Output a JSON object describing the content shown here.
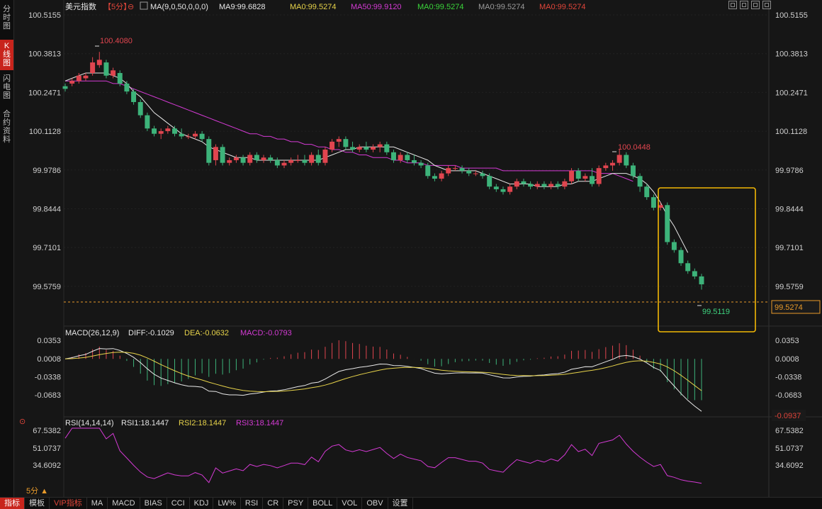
{
  "sidebar": {
    "tabs": [
      {
        "label": "分\n时\n图",
        "active": false
      },
      {
        "label": "K\n线\n图",
        "active": true
      },
      {
        "label": "闪\n电\n图",
        "active": false
      },
      {
        "label": "合\n约\n资\n料",
        "active": false
      }
    ]
  },
  "header": {
    "symbol": "美元指数",
    "period": "【5分】",
    "ma_config": "MA(9,0,50,0,0,0)",
    "items": [
      {
        "text": "MA9:99.6828",
        "color": "#e8e8e8"
      },
      {
        "text": "MA0:99.5274",
        "color": "#e7d34a"
      },
      {
        "text": "MA50:99.9120",
        "color": "#d43ad4"
      },
      {
        "text": "MA0:99.5274",
        "color": "#3ad43a"
      },
      {
        "text": "MA0:99.5274",
        "color": "#9a9a9a"
      },
      {
        "text": "MA0:99.5274",
        "color": "#e0453a"
      }
    ]
  },
  "price_axis": {
    "ticks": [
      "100.5155",
      "100.3813",
      "100.2471",
      "100.1128",
      "99.9786",
      "99.8444",
      "99.7101",
      "99.5759"
    ],
    "current_price": "99.5274"
  },
  "annotations": {
    "high1": "100.4080",
    "high2": "100.0448",
    "low": "99.5119"
  },
  "macd": {
    "title": "MACD(26,12,9)",
    "diff": "DIFF:-0.1029",
    "dea": "DEA:-0.0632",
    "macd": "MACD:-0.0793",
    "ticks": [
      "0.0353",
      "0.0008",
      "-0.0338",
      "-0.0683"
    ],
    "current": "-0.0937"
  },
  "rsi": {
    "title": "RSI(14,14,14)",
    "rsi1": "RSI1:18.1447",
    "rsi2": "RSI2:18.1447",
    "rsi3": "RSI3:18.1447",
    "ticks": [
      "67.5382",
      "51.0737",
      "34.6092"
    ]
  },
  "period_selector": "5分 ▲",
  "bottom_tabs": [
    "指标",
    "模板",
    "VIP指标",
    "MA",
    "MACD",
    "BIAS",
    "CCI",
    "KDJ",
    "LW%",
    "RSI",
    "CR",
    "PSY",
    "BOLL",
    "VOL",
    "OBV",
    "设置"
  ],
  "colors": {
    "up": "#e0454f",
    "down": "#3db37a",
    "ma9": "#e8e8e8",
    "ma50": "#d43ad4",
    "highlight": "#f2b705"
  },
  "chart_data": {
    "type": "candlestick",
    "x_interval": "5分",
    "ylim": [
      99.49,
      100.55
    ],
    "candles": [
      [
        100.28,
        100.29,
        100.26,
        100.27
      ],
      [
        100.29,
        100.31,
        100.28,
        100.3
      ],
      [
        100.3,
        100.33,
        100.29,
        100.32
      ],
      [
        100.31,
        100.33,
        100.3,
        100.32
      ],
      [
        100.33,
        100.39,
        100.32,
        100.37
      ],
      [
        100.36,
        100.41,
        100.35,
        100.38
      ],
      [
        100.37,
        100.38,
        100.31,
        100.32
      ],
      [
        100.32,
        100.35,
        100.31,
        100.34
      ],
      [
        100.33,
        100.34,
        100.28,
        100.29
      ],
      [
        100.29,
        100.3,
        100.25,
        100.26
      ],
      [
        100.26,
        100.27,
        100.21,
        100.22
      ],
      [
        100.22,
        100.23,
        100.16,
        100.17
      ],
      [
        100.17,
        100.18,
        100.11,
        100.12
      ],
      [
        100.12,
        100.13,
        100.09,
        100.1
      ],
      [
        100.1,
        100.12,
        100.08,
        100.11
      ],
      [
        100.11,
        100.13,
        100.1,
        100.12
      ],
      [
        100.12,
        100.13,
        100.09,
        100.1
      ],
      [
        100.1,
        100.12,
        100.08,
        100.09
      ],
      [
        100.09,
        100.1,
        100.08,
        100.09
      ],
      [
        100.09,
        100.11,
        100.08,
        100.1
      ],
      [
        100.1,
        100.11,
        100.07,
        100.08
      ],
      [
        100.08,
        100.09,
        99.98,
        99.99
      ],
      [
        100.0,
        100.06,
        99.98,
        100.05
      ],
      [
        100.05,
        100.06,
        99.98,
        99.99
      ],
      [
        99.99,
        100.01,
        99.98,
        100.0
      ],
      [
        100.0,
        100.02,
        99.99,
        100.01
      ],
      [
        100.01,
        100.02,
        99.98,
        99.99
      ],
      [
        99.99,
        100.03,
        99.98,
        100.02
      ],
      [
        100.02,
        100.03,
        99.99,
        100.0
      ],
      [
        100.0,
        100.02,
        99.99,
        100.01
      ],
      [
        100.01,
        100.02,
        99.99,
        100.0
      ],
      [
        100.0,
        100.01,
        99.97,
        99.98
      ],
      [
        99.98,
        100.0,
        99.97,
        99.99
      ],
      [
        99.99,
        100.01,
        99.98,
        100.0
      ],
      [
        100.0,
        100.02,
        99.99,
        100.0
      ],
      [
        100.0,
        100.02,
        99.98,
        99.99
      ],
      [
        99.99,
        100.03,
        99.98,
        100.02
      ],
      [
        100.02,
        100.04,
        99.98,
        99.99
      ],
      [
        99.99,
        100.05,
        99.98,
        100.04
      ],
      [
        100.04,
        100.08,
        100.03,
        100.07
      ],
      [
        100.07,
        100.09,
        100.05,
        100.08
      ],
      [
        100.08,
        100.09,
        100.04,
        100.05
      ],
      [
        100.05,
        100.07,
        100.03,
        100.04
      ],
      [
        100.04,
        100.06,
        100.03,
        100.05
      ],
      [
        100.05,
        100.07,
        100.03,
        100.04
      ],
      [
        100.04,
        100.06,
        100.03,
        100.05
      ],
      [
        100.05,
        100.07,
        100.03,
        100.06
      ],
      [
        100.06,
        100.07,
        100.02,
        100.03
      ],
      [
        100.03,
        100.04,
        99.99,
        100.0
      ],
      [
        100.0,
        100.03,
        99.99,
        100.02
      ],
      [
        100.02,
        100.03,
        99.99,
        100.0
      ],
      [
        100.0,
        100.02,
        99.98,
        99.99
      ],
      [
        99.99,
        100.0,
        99.97,
        99.98
      ],
      [
        99.98,
        99.99,
        99.93,
        99.94
      ],
      [
        99.94,
        99.95,
        99.92,
        99.93
      ],
      [
        99.93,
        99.96,
        99.92,
        99.95
      ],
      [
        99.95,
        99.98,
        99.94,
        99.97
      ],
      [
        99.97,
        99.98,
        99.96,
        99.97
      ],
      [
        99.97,
        99.98,
        99.95,
        99.96
      ],
      [
        99.96,
        99.97,
        99.94,
        99.95
      ],
      [
        99.95,
        99.96,
        99.94,
        99.95
      ],
      [
        99.95,
        99.96,
        99.93,
        99.94
      ],
      [
        99.94,
        99.95,
        99.89,
        99.9
      ],
      [
        99.9,
        99.91,
        99.88,
        99.89
      ],
      [
        99.89,
        99.9,
        99.87,
        99.88
      ],
      [
        99.88,
        99.91,
        99.87,
        99.9
      ],
      [
        99.9,
        99.93,
        99.89,
        99.92
      ],
      [
        99.92,
        99.93,
        99.9,
        99.91
      ],
      [
        99.91,
        99.92,
        99.89,
        99.9
      ],
      [
        99.9,
        99.92,
        99.89,
        99.91
      ],
      [
        99.91,
        99.92,
        99.89,
        99.9
      ],
      [
        99.9,
        99.92,
        99.89,
        99.91
      ],
      [
        99.91,
        99.92,
        99.89,
        99.9
      ],
      [
        99.9,
        99.93,
        99.89,
        99.92
      ],
      [
        99.92,
        99.97,
        99.91,
        99.96
      ],
      [
        99.96,
        99.97,
        99.92,
        99.93
      ],
      [
        99.93,
        99.95,
        99.92,
        99.94
      ],
      [
        99.94,
        99.97,
        99.9,
        99.91
      ],
      [
        99.91,
        99.98,
        99.9,
        99.97
      ],
      [
        99.97,
        99.99,
        99.96,
        99.98
      ],
      [
        99.98,
        100.0,
        99.96,
        99.99
      ],
      [
        99.99,
        100.04,
        99.98,
        100.02
      ],
      [
        100.02,
        100.03,
        99.97,
        99.98
      ],
      [
        99.98,
        99.99,
        99.93,
        99.94
      ],
      [
        99.94,
        99.95,
        99.88,
        99.9
      ],
      [
        99.9,
        99.91,
        99.85,
        99.86
      ],
      [
        99.86,
        99.87,
        99.81,
        99.82
      ],
      [
        99.82,
        99.84,
        99.81,
        99.83
      ],
      [
        99.83,
        99.84,
        99.68,
        99.69
      ],
      [
        99.69,
        99.7,
        99.65,
        99.66
      ],
      [
        99.66,
        99.67,
        99.6,
        99.61
      ],
      [
        99.61,
        99.62,
        99.57,
        99.58
      ],
      [
        99.58,
        99.59,
        99.55,
        99.56
      ],
      [
        99.56,
        99.57,
        99.51,
        99.53
      ]
    ],
    "ma9": [
      100.3,
      100.31,
      100.32,
      100.33,
      100.33,
      100.33,
      100.33,
      100.32,
      100.31,
      100.29,
      100.26,
      100.24,
      100.21,
      100.18,
      100.16,
      100.14,
      100.12,
      100.1,
      100.09,
      100.08,
      100.07,
      100.05,
      100.04,
      100.03,
      100.02,
      100.01,
      100.01,
      100.01,
      100.0,
      100.0,
      100.0,
      100.0,
      100.0,
      100.0,
      100.0,
      100.0,
      100.0,
      100.0,
      100.01,
      100.02,
      100.03,
      100.04,
      100.04,
      100.05,
      100.05,
      100.05,
      100.05,
      100.05,
      100.05,
      100.04,
      100.03,
      100.02,
      100.01,
      100.0,
      99.98,
      99.97,
      99.96,
      99.96,
      99.96,
      99.96,
      99.96,
      99.95,
      99.94,
      99.93,
      99.92,
      99.91,
      99.91,
      99.91,
      99.91,
      99.9,
      99.9,
      99.9,
      99.9,
      99.91,
      99.91,
      99.92,
      99.92,
      99.92,
      99.93,
      99.94,
      99.95,
      99.95,
      99.95,
      99.94,
      99.93,
      99.91,
      99.88,
      99.84,
      99.79,
      99.75,
      99.7,
      99.65
    ],
    "ma50": [
      100.3,
      100.3,
      100.3,
      100.3,
      100.3,
      100.3,
      100.3,
      100.29,
      100.29,
      100.28,
      100.27,
      100.26,
      100.25,
      100.24,
      100.23,
      100.22,
      100.21,
      100.2,
      100.19,
      100.18,
      100.17,
      100.16,
      100.15,
      100.14,
      100.13,
      100.12,
      100.11,
      100.1,
      100.1,
      100.09,
      100.09,
      100.08,
      100.08,
      100.07,
      100.07,
      100.06,
      100.06,
      100.05,
      100.05,
      100.04,
      100.04,
      100.03,
      100.03,
      100.02,
      100.02,
      100.01,
      100.01,
      100.01,
      100.0,
      100.0,
      99.99,
      99.99,
      99.99,
      99.98,
      99.98,
      99.98,
      99.98,
      99.98,
      99.97,
      99.97,
      99.97,
      99.97,
      99.97,
      99.97,
      99.96,
      99.96,
      99.96,
      99.96,
      99.96,
      99.96,
      99.96,
      99.96,
      99.96,
      99.96,
      99.96,
      99.96,
      99.96,
      99.96,
      99.95,
      99.95,
      99.95,
      99.94,
      99.93,
      99.92
    ]
  }
}
